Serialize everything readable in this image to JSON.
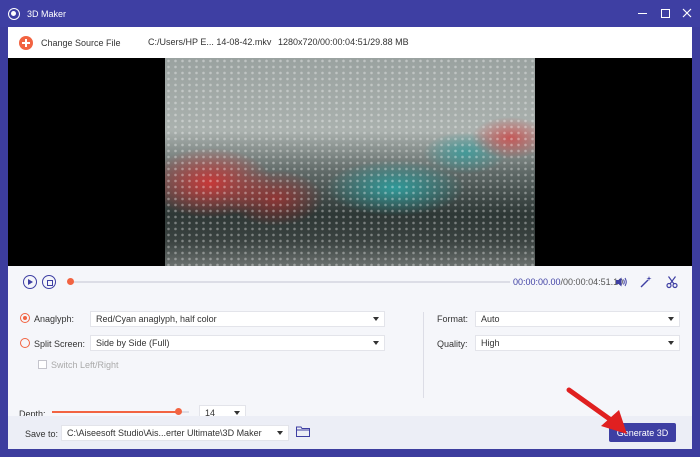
{
  "window": {
    "title": "3D Maker"
  },
  "source": {
    "change_label": "Change Source File",
    "file_path": "C:/Users/HP E... 14-08-42.mkv",
    "file_info": "1280x720/00:00:04:51/29.88 MB"
  },
  "playback": {
    "current_time": "00:00:00.00",
    "total_time": "/00:00:04:51.10",
    "progress": 0.0
  },
  "settings": {
    "anaglyph_label": "Anaglyph:",
    "anaglyph_value": "Red/Cyan anaglyph, half color",
    "split_label": "Split Screen:",
    "split_value": "Side by Side (Full)",
    "switch_label": "Switch Left/Right",
    "depth_label": "Depth:",
    "depth_value": "14",
    "format_label": "Format:",
    "format_value": "Auto",
    "quality_label": "Quality:",
    "quality_value": "High"
  },
  "save": {
    "label": "Save to:",
    "path": "C:\\Aiseesoft Studio\\Ais...erter Ultimate\\3D Maker",
    "generate_label": "Generate 3D"
  },
  "colors": {
    "accent": "#3e3fa3",
    "orange": "#f26341",
    "annotation": "#e02020"
  }
}
